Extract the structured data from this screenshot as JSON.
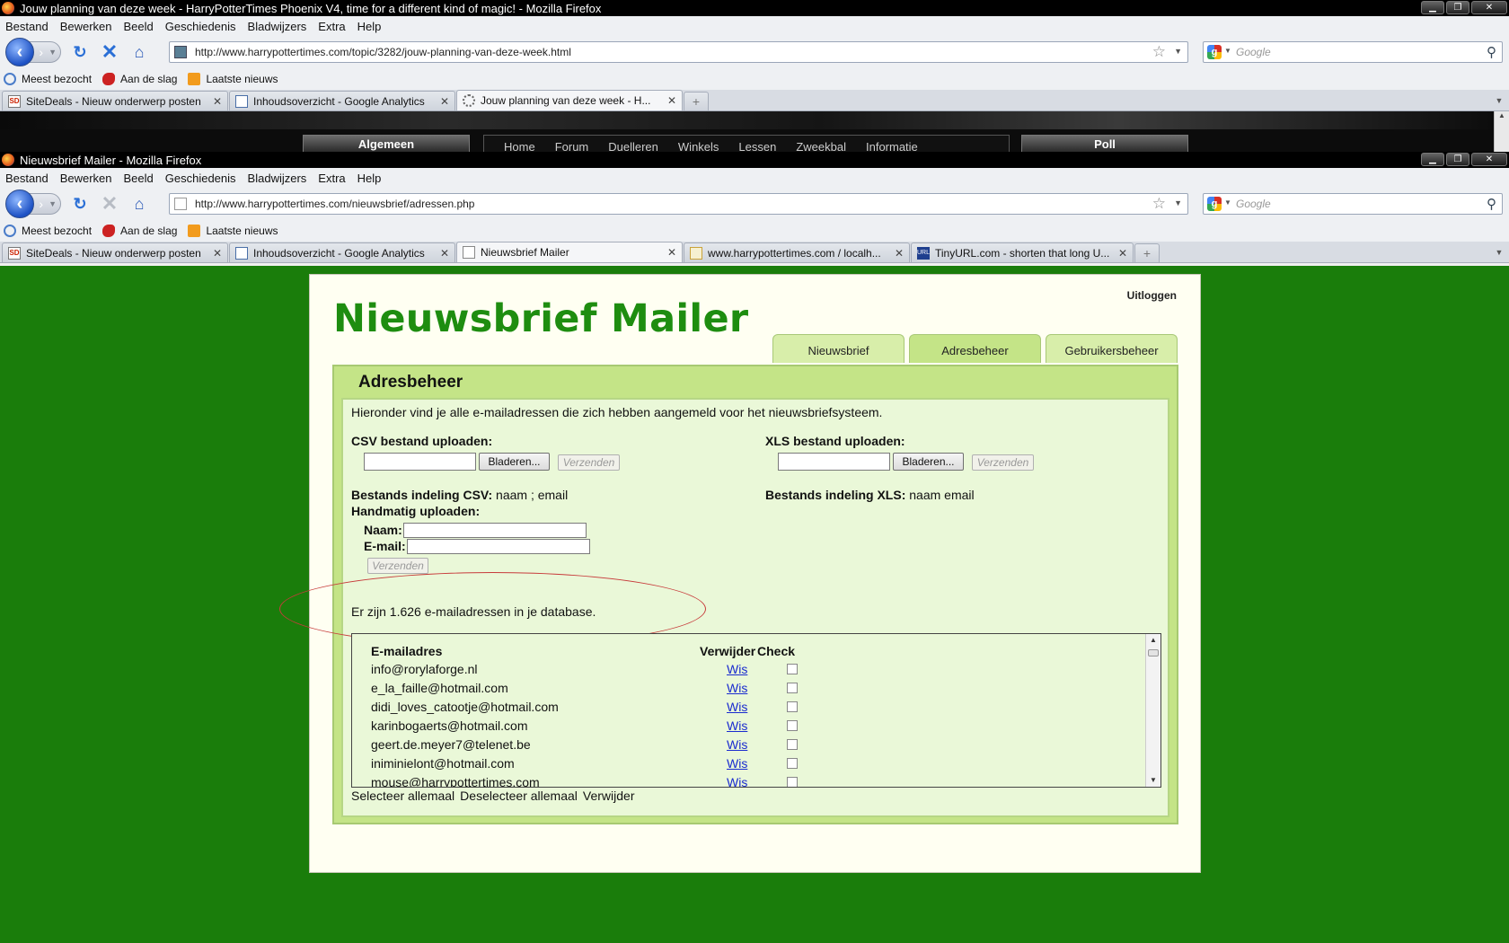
{
  "window1": {
    "title": "Jouw planning van deze week - HarryPotterTimes Phoenix V4, time for a different kind of magic! - Mozilla Firefox",
    "url": "http://www.harrypottertimes.com/topic/3282/jouw-planning-van-deze-week.html",
    "tabs": [
      {
        "label": "SiteDeals - Nieuw onderwerp posten",
        "icon": "sitedeals-icon"
      },
      {
        "label": "Inhoudsoverzicht - Google Analytics",
        "icon": "analytics-icon"
      },
      {
        "label": "Jouw planning van deze week - H...",
        "icon": "loading-icon"
      }
    ],
    "site_peek": {
      "left_button": "Algemeen",
      "nav": [
        "Home",
        "Forum",
        "Duelleren",
        "Winkels",
        "Lessen",
        "Zweekbal",
        "Informatie"
      ],
      "right_button": "Poll"
    }
  },
  "window2": {
    "title": "Nieuwsbrief Mailer - Mozilla Firefox",
    "url": "http://www.harrypottertimes.com/nieuwsbrief/adressen.php",
    "tabs": [
      {
        "label": "SiteDeals - Nieuw onderwerp posten",
        "icon": "sitedeals-icon"
      },
      {
        "label": "Inhoudsoverzicht - Google Analytics",
        "icon": "analytics-icon"
      },
      {
        "label": "Nieuwsbrief Mailer",
        "icon": "page-icon"
      },
      {
        "label": "www.harrypottertimes.com / localh...",
        "icon": "phpmyadmin-icon"
      },
      {
        "label": "TinyURL.com - shorten that long U...",
        "icon": "tinyurl-icon"
      }
    ]
  },
  "menu": [
    "Bestand",
    "Bewerken",
    "Beeld",
    "Geschiedenis",
    "Bladwijzers",
    "Extra",
    "Help"
  ],
  "bookmarks": [
    {
      "label": "Meest bezocht",
      "icon": "most-visited-icon"
    },
    {
      "label": "Aan de slag",
      "icon": "getting-started-icon"
    },
    {
      "label": "Laatste nieuws",
      "icon": "rss-icon"
    }
  ],
  "search_placeholder": "Google",
  "page": {
    "logout": "Uitloggen",
    "logo": "Nieuwsbrief Mailer",
    "nav_tabs": [
      "Nieuwsbrief",
      "Adresbeheer",
      "Gebruikersbeheer"
    ],
    "active_tab": "Adresbeheer",
    "section_title": "Adresbeheer",
    "intro": "Hieronder vind je alle e-mailadressen die zich hebben aangemeld voor het nieuwsbriefsysteem.",
    "csv_upload_label": "CSV bestand uploaden:",
    "xls_upload_label": "XLS bestand uploaden:",
    "browse_label": "Bladeren...",
    "send_label": "Verzenden",
    "csv_format_label": "Bestands indeling CSV:",
    "csv_format_value": "naam ; email",
    "xls_format_label": "Bestands indeling XLS:",
    "xls_format_value": "naam email",
    "manual_label": "Handmatig uploaden:",
    "name_label": "Naam:",
    "email_label": "E-mail:",
    "count_text": "Er zijn 1.626 e-mailadressen in je database.",
    "list_headers": {
      "email": "E-mailadres",
      "delete": "Verwijder",
      "check": "Check"
    },
    "delete_link": "Wis",
    "emails": [
      "info@rorylaforge.nl",
      "e_la_faille@hotmail.com",
      "didi_loves_catootje@hotmail.com",
      "karinbogaerts@hotmail.com",
      "geert.de.meyer7@telenet.be",
      "iniminielont@hotmail.com",
      "mouse@harrypottertimes.com"
    ],
    "actions": [
      "Selecteer allemaal",
      "Deselecteer allemaal",
      "Verwijder"
    ]
  },
  "colors": {
    "page_background": "#1a7d0b",
    "logo_green": "#1e8d10",
    "panel_green": "#c4e487",
    "link_blue": "#1a2bcf",
    "annotation_red": "#c73b3b"
  }
}
